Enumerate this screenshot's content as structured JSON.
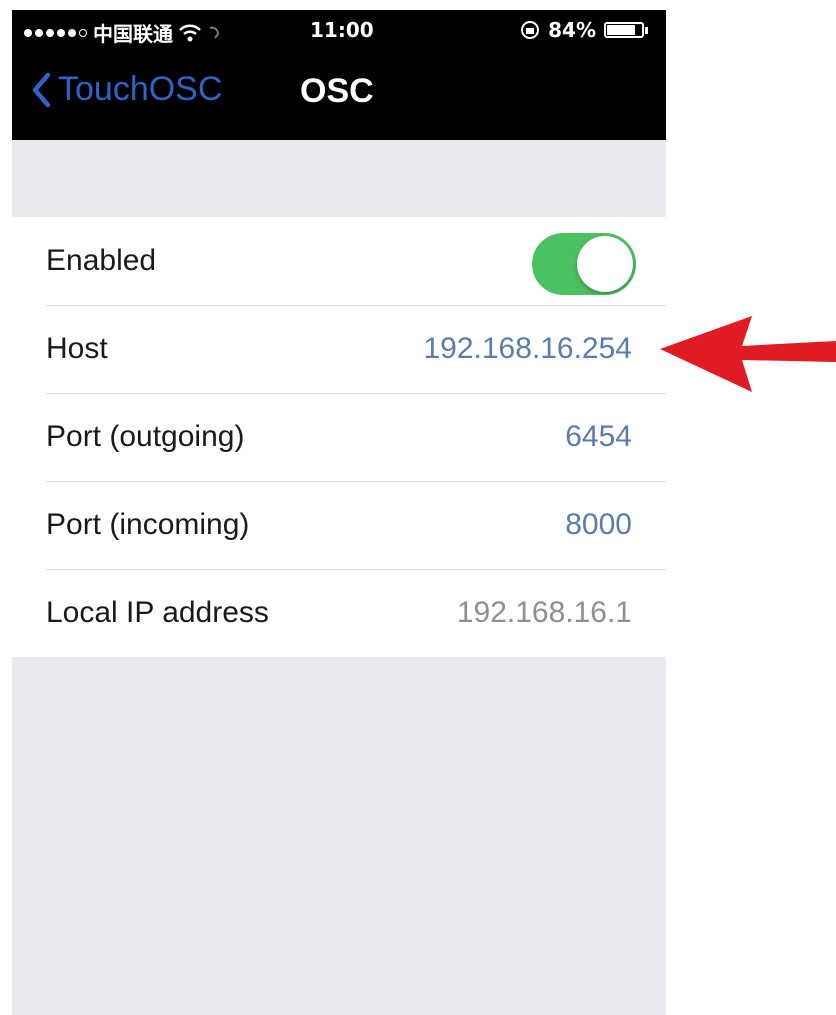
{
  "status_bar": {
    "signal_icon": "signal-dots-icon",
    "carrier": "中国联通",
    "wifi_icon": "wifi-icon",
    "time": "11:00",
    "rotation_lock_icon": "rotation-lock-icon",
    "battery_percent": "84%",
    "battery_level": 0.84
  },
  "nav": {
    "back_label": "TouchOSC",
    "title": "OSC",
    "back_icon": "chevron-left-icon"
  },
  "rows": {
    "enabled": {
      "label": "Enabled",
      "on": true
    },
    "host": {
      "label": "Host",
      "value": "192.168.16.254"
    },
    "port_out": {
      "label": "Port (outgoing)",
      "value": "6454"
    },
    "port_in": {
      "label": "Port (incoming)",
      "value": "8000"
    },
    "local_ip": {
      "label": "Local IP address",
      "value": "192.168.16.1"
    }
  },
  "colors": {
    "toggle_on": "#4cc161",
    "link": "#2f63c7",
    "value_blue": "#5a7bae",
    "annotation_arrow": "#e01b24"
  },
  "annotation": {
    "icon": "red-arrow-icon"
  }
}
